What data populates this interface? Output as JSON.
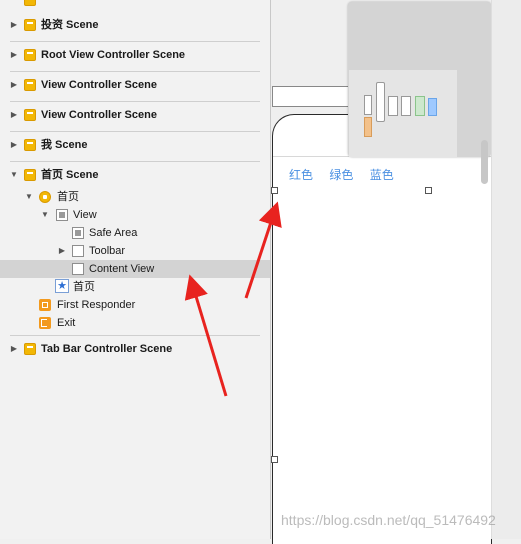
{
  "outline": {
    "scenes": [
      {
        "label": "投资 Scene"
      },
      {
        "label": "Root View Controller Scene"
      },
      {
        "label": "View Controller Scene"
      },
      {
        "label": "View Controller Scene"
      },
      {
        "label": "我 Scene"
      },
      {
        "label": "首页 Scene"
      },
      {
        "label": "Tab Bar Controller Scene"
      }
    ],
    "tree": {
      "vc": "首页",
      "view": "View",
      "safe_area": "Safe Area",
      "toolbar": "Toolbar",
      "content_view": "Content View",
      "tab_item": "首页",
      "first_responder": "First Responder",
      "exit": "Exit"
    }
  },
  "canvas": {
    "segments": [
      "红色",
      "绿色",
      "蓝色"
    ]
  },
  "watermark": "https://blog.csdn.net/qq_51476492",
  "colors": {
    "segment_text": "#4a90e2",
    "arrow": "#e8231f",
    "scene_icon": "#f2b705"
  }
}
